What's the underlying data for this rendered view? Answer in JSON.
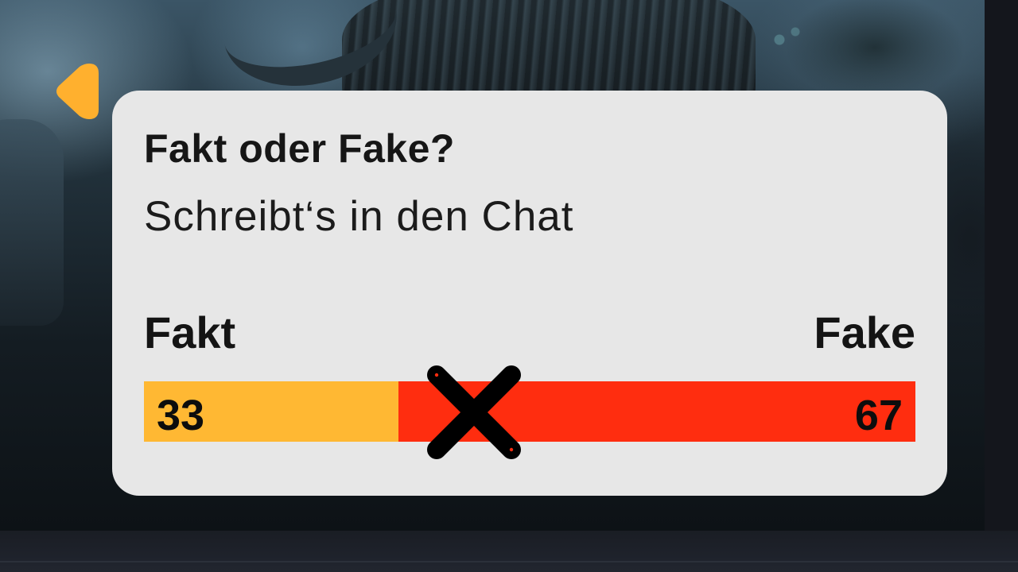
{
  "poll": {
    "title": "Fakt oder Fake?",
    "subtitle": "Schreibt‘s in den Chat",
    "options": [
      {
        "label": "Fakt",
        "value": 33,
        "color": "#ffb833"
      },
      {
        "label": "Fake",
        "value": 67,
        "color": "#ff2d0f"
      }
    ]
  },
  "icons": {
    "prev": "triangle-left-icon",
    "versus": "x-cross-icon"
  },
  "colors": {
    "card_background": "#e7e7e7",
    "arrow": "#ffb02e",
    "text": "#141414"
  }
}
